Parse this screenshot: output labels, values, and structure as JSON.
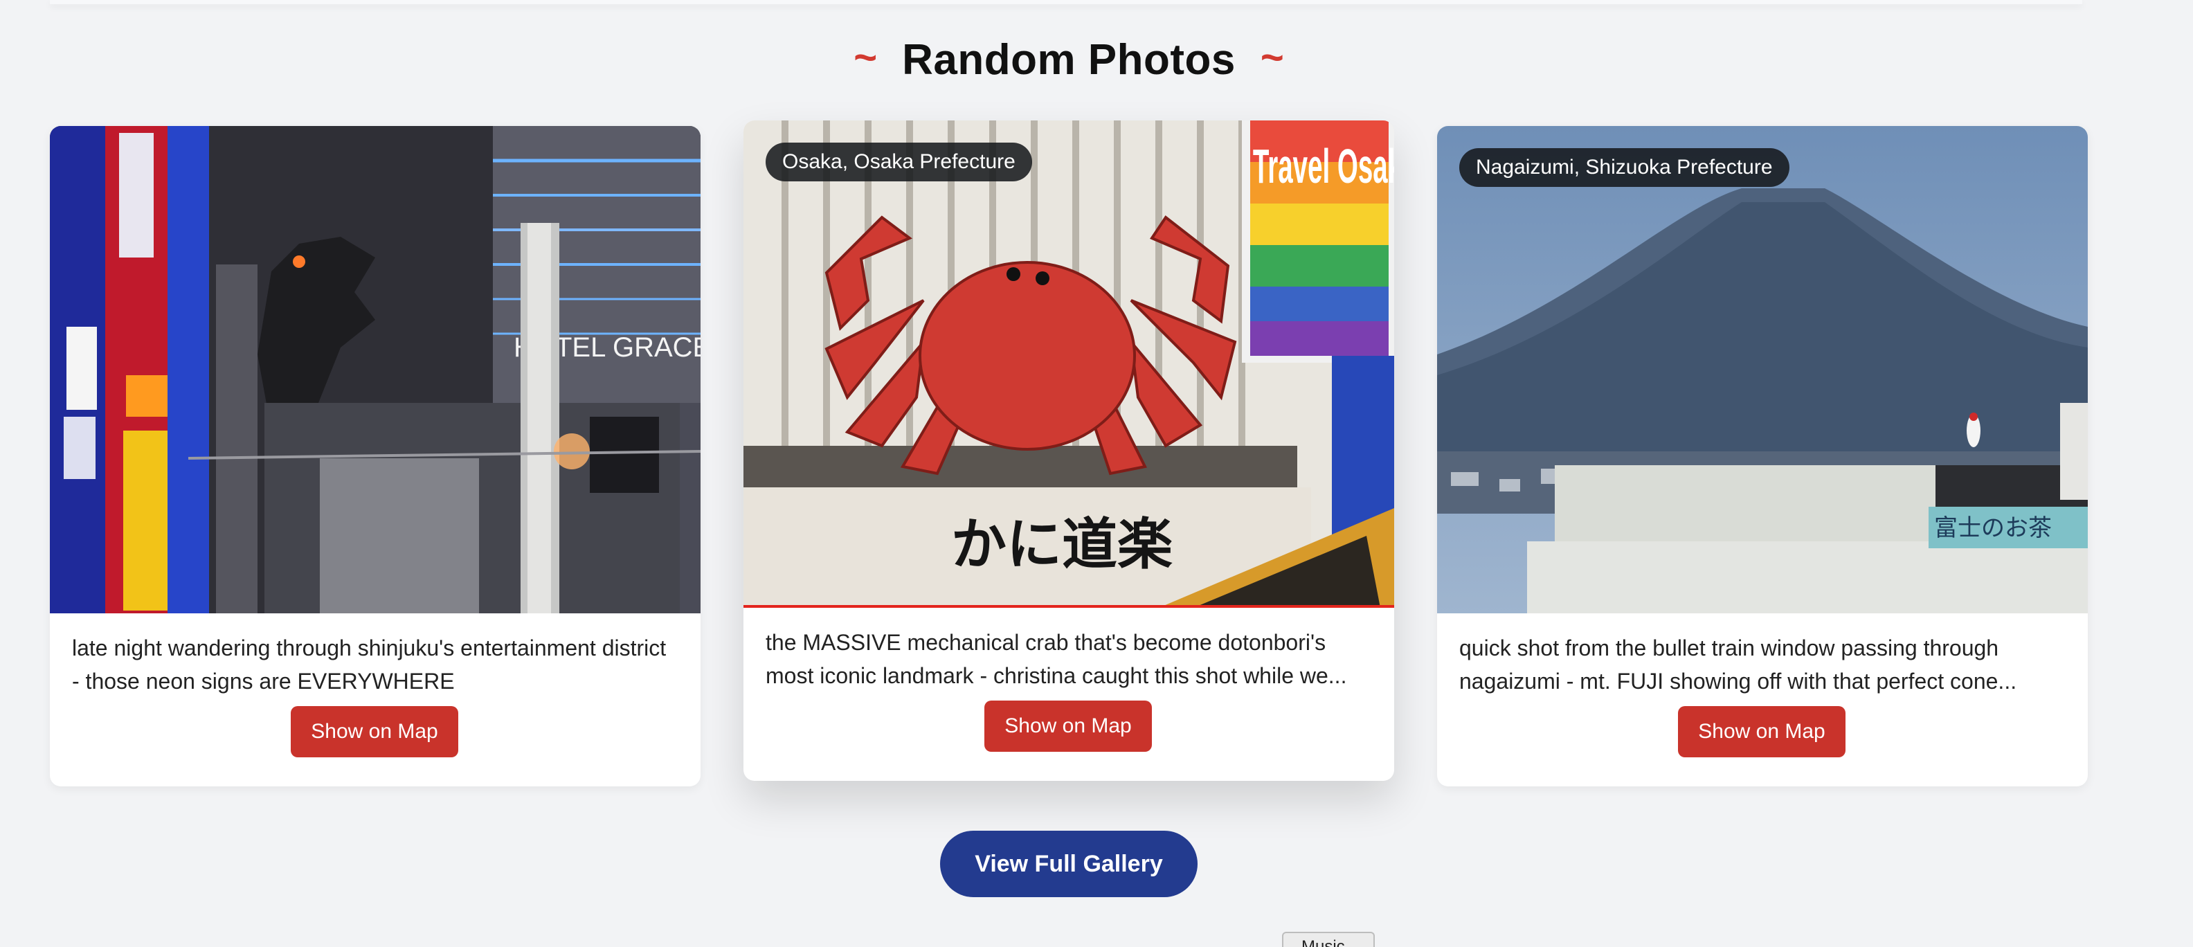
{
  "section": {
    "title": "Random Photos",
    "decoration": "~"
  },
  "cards": [
    {
      "location": "",
      "caption": "late night wandering through shinjuku's entertainment district - those neon signs are EVERYWHERE",
      "button_label": "Show on Map",
      "sign_text": "HOTEL GRACE"
    },
    {
      "location": "Osaka, Osaka Prefecture",
      "caption": "the MASSIVE mechanical crab that's become dotonbori's most iconic landmark - christina caught this shot while we...",
      "button_label": "Show on Map",
      "sign_text": "Travel Osaka with Pride"
    },
    {
      "location": "Nagaizumi, Shizuoka Prefecture",
      "caption": "quick shot from the bullet train window passing through nagaizumi - mt. FUJI showing off with that perfect cone...",
      "button_label": "Show on Map",
      "sign_text": "富士のお茶"
    }
  ],
  "gallery_button": {
    "label": "View Full Gallery"
  },
  "mini_tab": {
    "label": "Music"
  },
  "colors": {
    "accent_red": "#c9332b",
    "primary_blue": "#233b8f",
    "background": "#f2f3f5"
  }
}
